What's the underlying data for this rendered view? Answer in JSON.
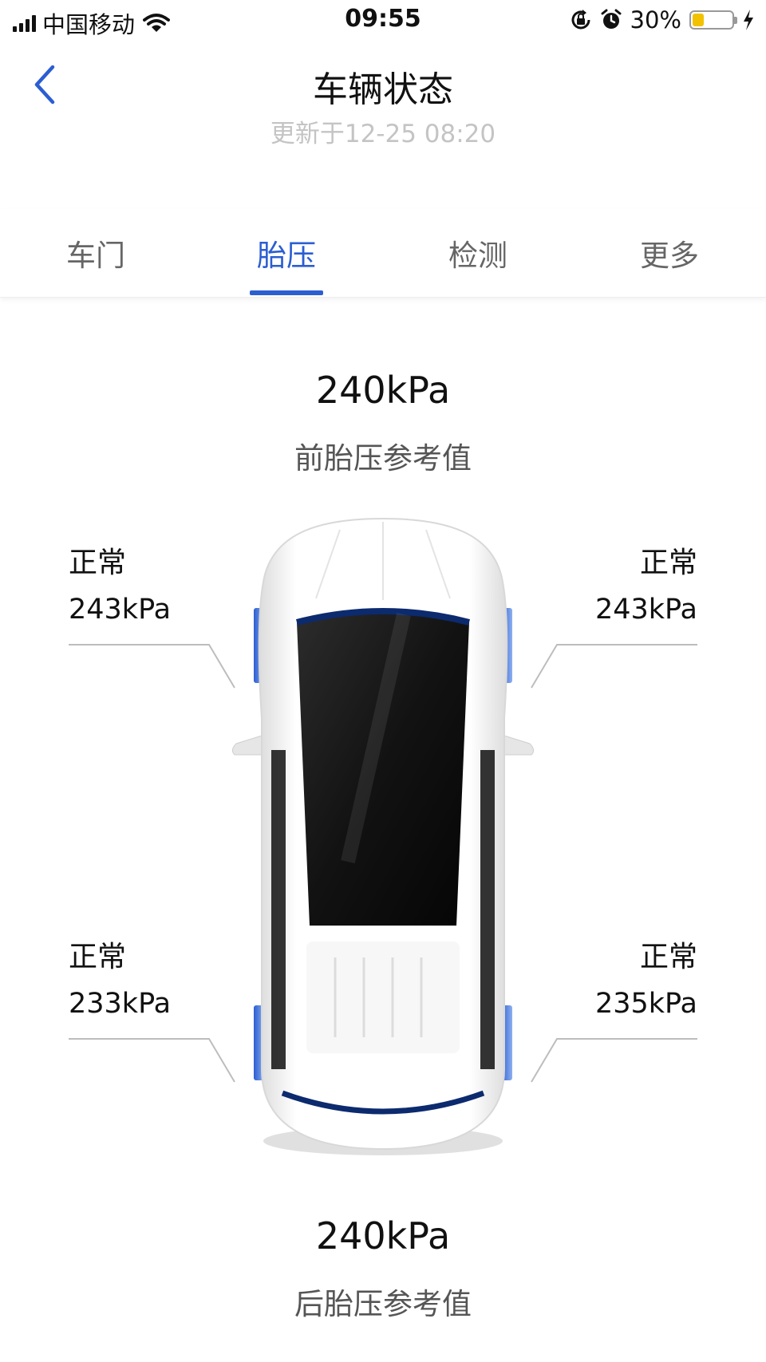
{
  "status_bar": {
    "carrier": "中国移动",
    "time": "09:55",
    "battery": "30%",
    "battery_level": 0.3,
    "icons": [
      "signal-icon",
      "wifi-icon",
      "orientation-lock-icon",
      "alarm-icon",
      "battery-icon",
      "charging-icon"
    ]
  },
  "header": {
    "title": "车辆状态",
    "subtitle": "更新于12-25 08:20",
    "back_icon": "chevron-left-icon"
  },
  "tabs": [
    {
      "label": "车门",
      "active": false
    },
    {
      "label": "胎压",
      "active": true
    },
    {
      "label": "检测",
      "active": false
    },
    {
      "label": "更多",
      "active": false
    }
  ],
  "front_reference": {
    "value": "240kPa",
    "label": "前胎压参考值"
  },
  "rear_reference": {
    "value": "240kPa",
    "label": "后胎压参考值"
  },
  "tires": {
    "front_left": {
      "status": "正常",
      "pressure": "243kPa"
    },
    "front_right": {
      "status": "正常",
      "pressure": "243kPa"
    },
    "rear_left": {
      "status": "正常",
      "pressure": "233kPa"
    },
    "rear_right": {
      "status": "正常",
      "pressure": "235kPa"
    }
  },
  "colors": {
    "accent": "#2b5ed1",
    "subtitle": "#c4c4c4",
    "battery": "#f2c200"
  }
}
